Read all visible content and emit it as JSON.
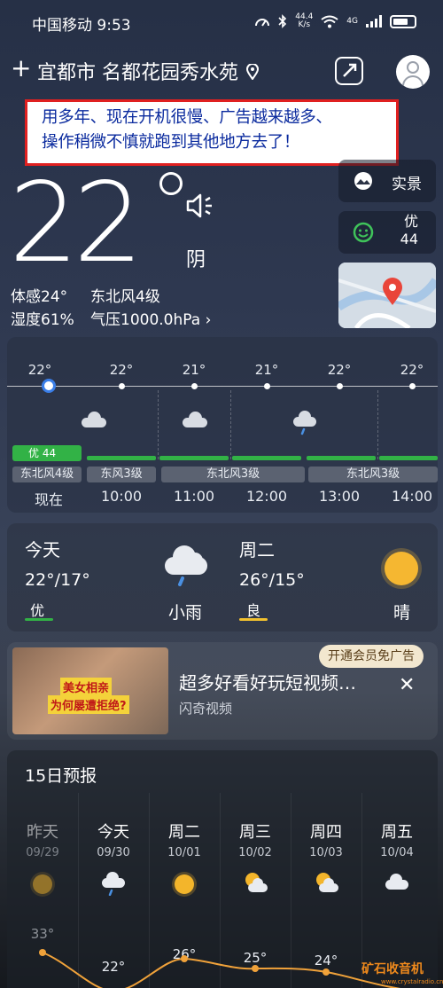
{
  "status_bar": {
    "carrier_time": "中国移动 9:53",
    "net_speed_top": "44.4",
    "net_speed_bottom": "K/s",
    "signal_label": "4G"
  },
  "header": {
    "location": "宜都市 名都花园秀水苑"
  },
  "annotation": {
    "line1": "用多年、现在开机很慢、广告越来越多、",
    "line2": "操作稍微不慎就跑到其他地方去了！"
  },
  "current": {
    "temperature": "22",
    "condition": "阴",
    "feels_like": "体感24°",
    "wind": "东北风4级",
    "humidity": "湿度61%",
    "pressure": "气压1000.0hPa ›"
  },
  "side_cards": {
    "realscene_label": "实景",
    "aqi_level": "优",
    "aqi_value": "44"
  },
  "hourly": {
    "aqi_pill": "优 44",
    "hours": [
      {
        "time": "现在",
        "temp": "22°",
        "icon": "cloud-icon"
      },
      {
        "time": "10:00",
        "temp": "22°",
        "icon": "cloud-icon"
      },
      {
        "time": "11:00",
        "temp": "21°",
        "icon": "cloud-icon"
      },
      {
        "time": "12:00",
        "temp": "21°",
        "icon": "rain-cloud-icon"
      },
      {
        "time": "13:00",
        "temp": "22°",
        "icon": "cloud-icon"
      },
      {
        "time": "14:00",
        "temp": "22°",
        "icon": "cloud-icon"
      }
    ],
    "wind_chips": [
      "东北风4级",
      "东风3级",
      "东北风3级",
      "东北风3级"
    ]
  },
  "two_day": {
    "today": {
      "day": "今天",
      "temp": "22°/17°",
      "aqi": "优",
      "condition": "小雨",
      "aqi_color": "#32b246"
    },
    "tomorrow": {
      "day": "周二",
      "temp": "26°/15°",
      "aqi": "良",
      "condition": "晴",
      "aqi_color": "#f2c12e"
    }
  },
  "ad": {
    "title": "超多好看好玩短视频…",
    "source": "闪奇视频",
    "vip_button": "开通会员免广告",
    "thumb_text1": "美女相亲",
    "thumb_text2": "为何屡遭拒绝?"
  },
  "forecast": {
    "title": "15日预报",
    "days": [
      {
        "day": "昨天",
        "date": "09/29",
        "high": "33°",
        "icon": "sun-icon"
      },
      {
        "day": "今天",
        "date": "09/30",
        "high": "22°",
        "icon": "rain-cloud-icon"
      },
      {
        "day": "周二",
        "date": "10/01",
        "high": "26°",
        "icon": "sun-icon"
      },
      {
        "day": "周三",
        "date": "10/02",
        "high": "25°",
        "icon": "sun-cloud-icon"
      },
      {
        "day": "周四",
        "date": "10/03",
        "high": "24°",
        "icon": "sun-cloud-icon"
      },
      {
        "day": "周五",
        "date": "10/04",
        "high": "",
        "icon": "cloud-icon"
      }
    ]
  },
  "watermark": {
    "text": "矿石收音机",
    "url": "www.crystalradio.cn"
  }
}
